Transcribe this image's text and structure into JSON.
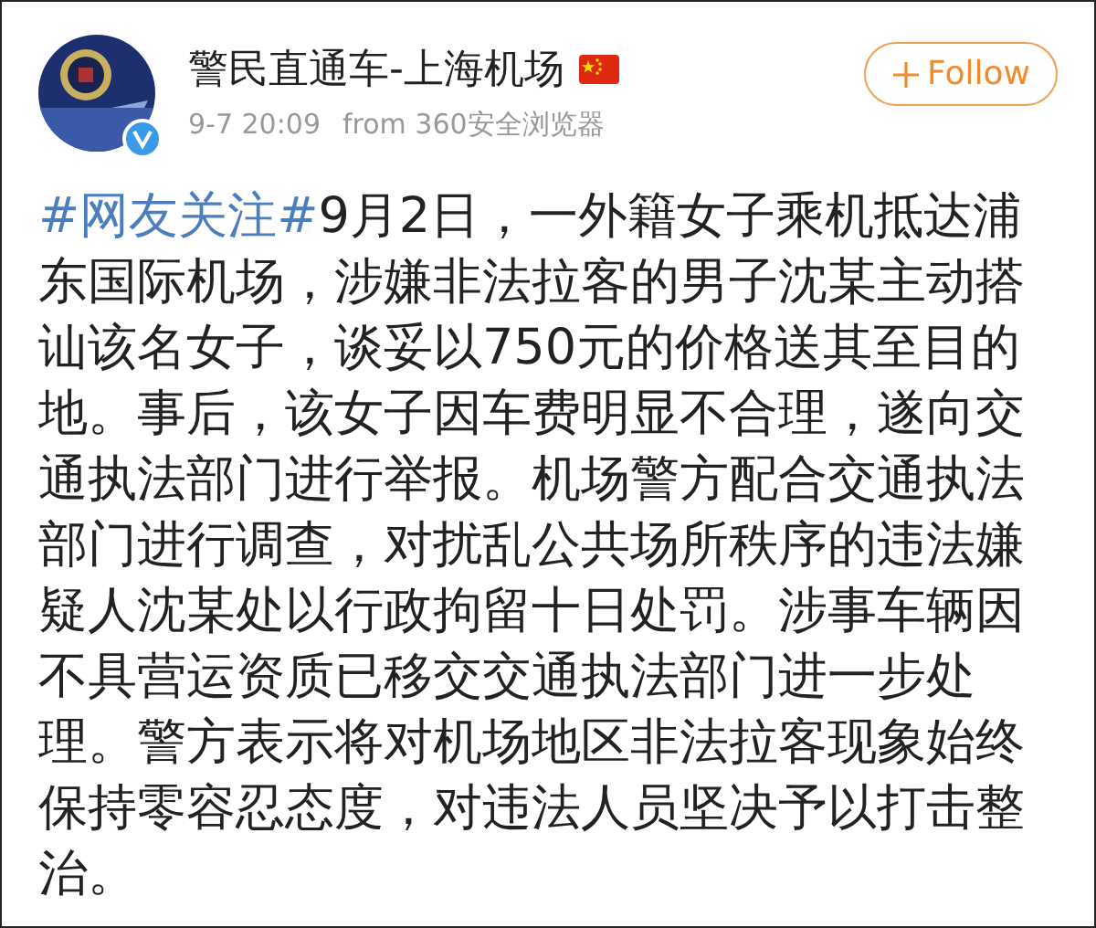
{
  "post": {
    "author": "警民直通车-上海机场",
    "verified": true,
    "time": "9-7 20:09",
    "source": "from 360安全浏览器",
    "follow_button": "Follow",
    "hashtag": "#网友关注#",
    "text": "9月2日，一外籍女子乘机抵达浦东国际机场，涉嫌非法拉客的男子沈某主动搭讪该名女子，谈妥以750元的价格送其至目的地。事后，该女子因车费明显不合理，遂向交通执法部门进行举报。机场警方配合交通执法部门进行调查，对扰乱公共场所秩序的违法嫌疑人沈某处以行政拘留十日处罚。涉事车辆因不具营运资质已移交交通执法部门进一步处理。警方表示将对机场地区非法拉客现象始终保持零容忍态度，对违法人员坚决予以打击整治。"
  }
}
